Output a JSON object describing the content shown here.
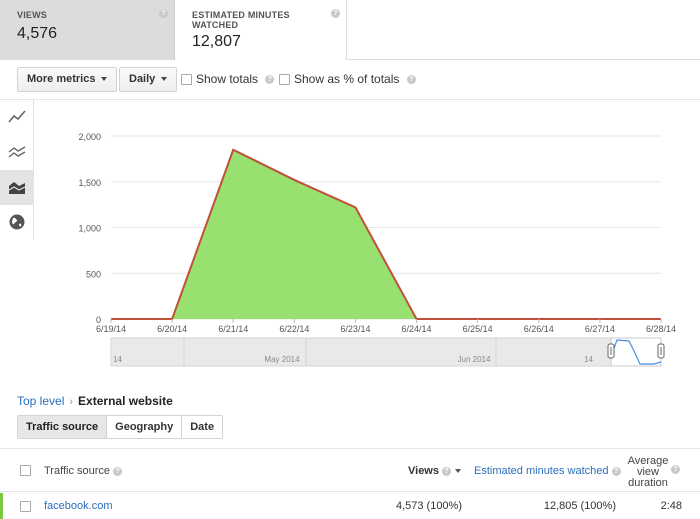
{
  "metrics": [
    {
      "label": "VIEWS",
      "value": "4,576"
    },
    {
      "label": "ESTIMATED MINUTES WATCHED",
      "value": "12,807"
    }
  ],
  "controls": {
    "more_metrics": "More metrics",
    "interval": "Daily",
    "show_totals": "Show totals",
    "show_percent": "Show as % of totals"
  },
  "sidebar_icons": [
    "line-chart-icon",
    "multiline-chart-icon",
    "stacked-area-chart-icon",
    "globe-map-icon"
  ],
  "chart_data": {
    "type": "area",
    "x": [
      "6/19/14",
      "6/20/14",
      "6/21/14",
      "6/22/14",
      "6/23/14",
      "6/24/14",
      "6/25/14",
      "6/26/14",
      "6/27/14",
      "6/28/14"
    ],
    "series": [
      {
        "values": [
          0,
          0,
          1850,
          1520,
          1220,
          0,
          0,
          0,
          0,
          0
        ]
      }
    ],
    "ylim": [
      0,
      2000
    ],
    "yticks": [
      0,
      500,
      1000,
      1500,
      2000
    ],
    "ytick_labels": [
      "0",
      "500",
      "1,000",
      "1,500",
      "2,000"
    ],
    "grid": true,
    "colors": {
      "fill": "#98e06f",
      "line": "#c0503a"
    },
    "navigator_labels": [
      "May 2014",
      "Jun 2014",
      "14",
      "14"
    ]
  },
  "breadcrumb": {
    "top": "Top level",
    "separator": "›",
    "current": "External website"
  },
  "subtabs": [
    "Traffic source",
    "Geography",
    "Date"
  ],
  "table": {
    "headers": {
      "source": "Traffic source",
      "views": "Views",
      "minutes": "Estimated minutes watched",
      "duration_line1": "Average",
      "duration_line2": "view",
      "duration_line3": "duration"
    },
    "rows": [
      {
        "source": "facebook.com",
        "views": "4,573 (100%)",
        "minutes": "12,805 (100%)",
        "duration": "2:48"
      }
    ]
  }
}
